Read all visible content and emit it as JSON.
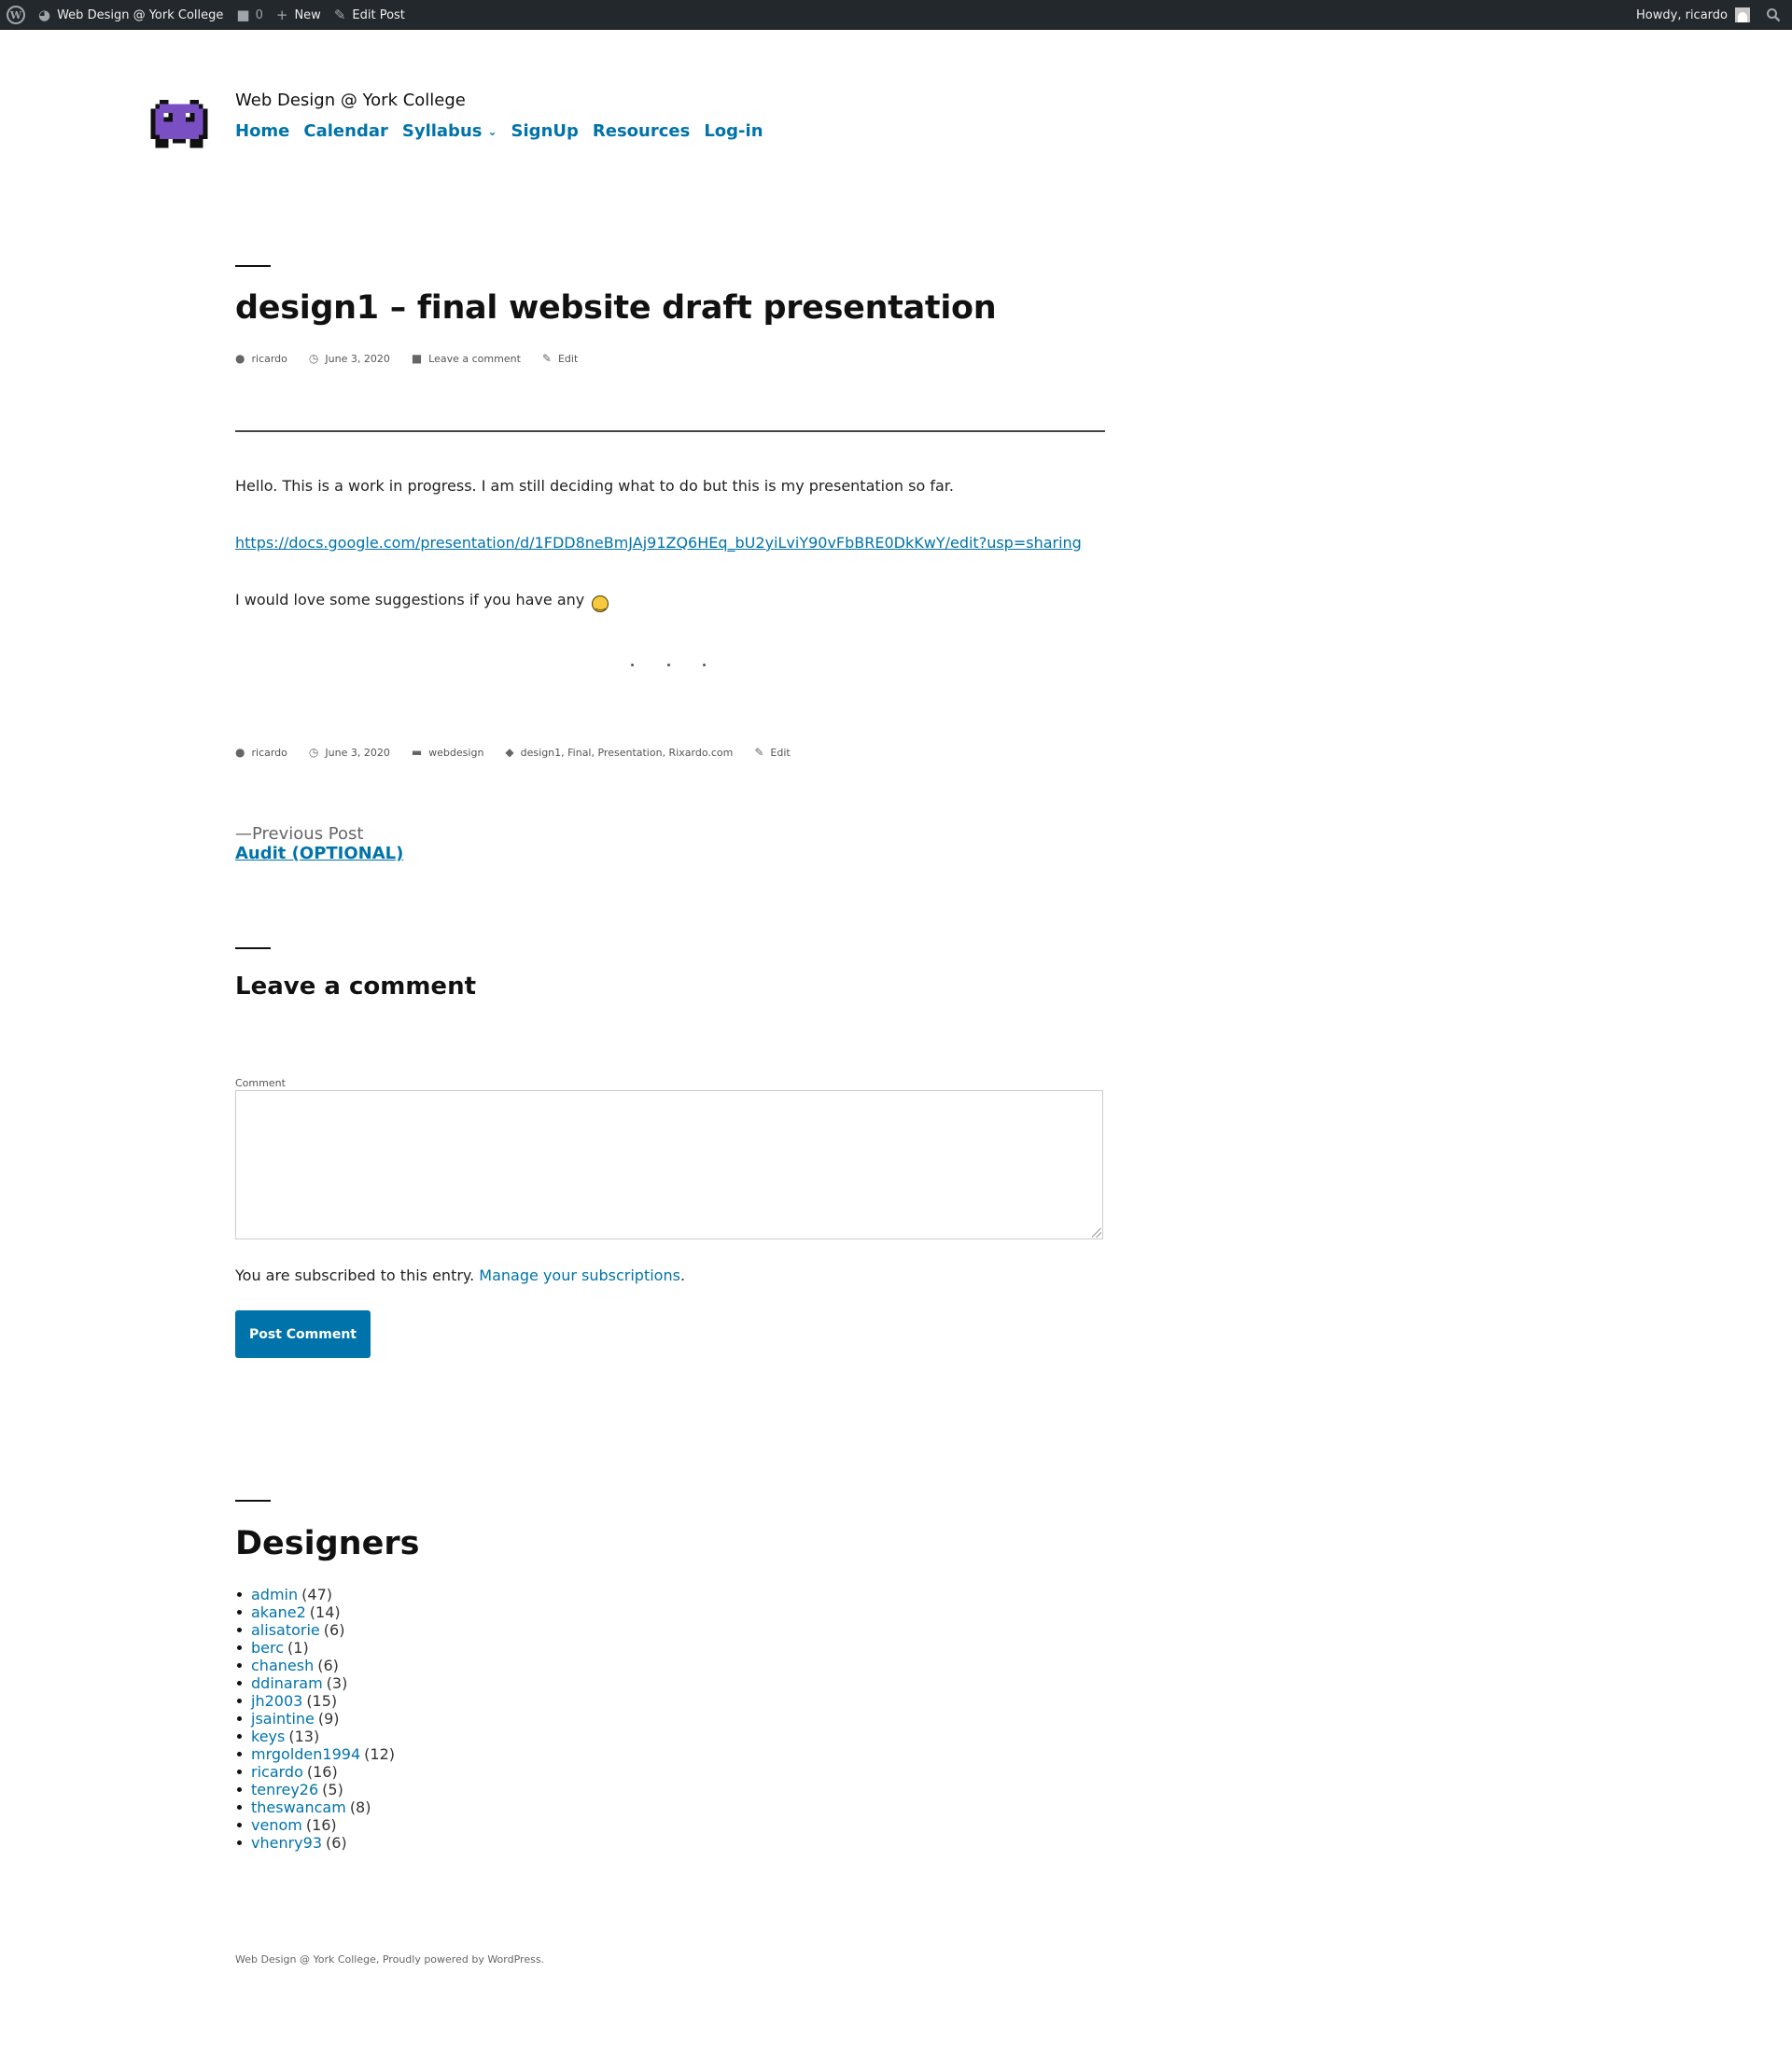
{
  "admin_bar": {
    "site_name": "Web Design @ York College",
    "comments_count": "0",
    "new_label": "New",
    "edit_post_label": "Edit Post",
    "howdy": "Howdy, ricardo"
  },
  "header": {
    "site_title": "Web Design @ York College",
    "nav": [
      "Home",
      "Calendar",
      "Syllabus",
      "SignUp",
      "Resources",
      "Log-in"
    ]
  },
  "post": {
    "title": "design1 – final website draft presentation",
    "meta_top": {
      "author": "ricardo",
      "date": "June 3, 2020",
      "comment": "Leave a comment",
      "edit": "Edit"
    },
    "paragraph1": "Hello. This is a work in progress. I am still deciding what to do but this is my presentation so far.",
    "link": "https://docs.google.com/presentation/d/1FDD8neBmJAj91ZQ6HEq_bU2yiLviY90vFbBRE0DkKwY/edit?usp=sharing",
    "paragraph3": "I would love some suggestions if you have any",
    "meta_bottom": {
      "author": "ricardo",
      "date": "June 3, 2020",
      "category": "webdesign",
      "tags": "design1, Final, Presentation, Rixardo.com",
      "edit": "Edit"
    }
  },
  "post_nav": {
    "prev_label": "—Previous Post",
    "prev_title": "Audit (OPTIONAL)"
  },
  "comments": {
    "title": "Leave a comment",
    "field_label": "Comment",
    "subscribed_text": "You are subscribed to this entry.",
    "manage_link": "Manage your subscriptions",
    "manage_suffix": ".",
    "post_button": "Post Comment"
  },
  "designers": {
    "title": "Designers",
    "items": [
      {
        "name": "admin",
        "count": "(47)"
      },
      {
        "name": "akane2",
        "count": "(14)"
      },
      {
        "name": "alisatorie",
        "count": "(6)"
      },
      {
        "name": "berc",
        "count": "(1)"
      },
      {
        "name": "chanesh",
        "count": "(6)"
      },
      {
        "name": "ddinaram",
        "count": "(3)"
      },
      {
        "name": "jh2003",
        "count": "(15)"
      },
      {
        "name": "jsaintine",
        "count": "(9)"
      },
      {
        "name": "keys",
        "count": "(13)"
      },
      {
        "name": "mrgolden1994",
        "count": "(12)"
      },
      {
        "name": "ricardo",
        "count": "(16)"
      },
      {
        "name": "tenrey26",
        "count": "(5)"
      },
      {
        "name": "theswancam",
        "count": "(8)"
      },
      {
        "name": "venom",
        "count": "(16)"
      },
      {
        "name": "vhenry93",
        "count": "(6)"
      }
    ]
  },
  "footer": {
    "text": "Web Design @ York College, Proudly powered by WordPress."
  },
  "colors": {
    "accent": "#0073aa",
    "admin_bar": "#23282d",
    "logo_purple": "#7b4fc4"
  }
}
